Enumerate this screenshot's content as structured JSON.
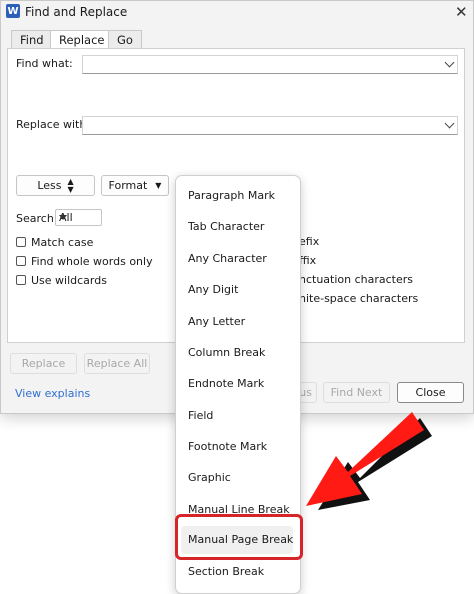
{
  "window": {
    "app_icon": "W",
    "title": "Find and Replace",
    "close_glyph": "✕"
  },
  "tabs": [
    {
      "label": "Find"
    },
    {
      "label": "Replace"
    },
    {
      "label": "Go To"
    }
  ],
  "find": {
    "label": "Find what:",
    "value": ""
  },
  "replace": {
    "label": "Replace with:",
    "value": ""
  },
  "buttons": {
    "less": "Less",
    "format": "Format",
    "replace": "Replace",
    "replace_all": "Replace All",
    "previous_partial": "ous",
    "find_next": "Find Next",
    "close": "Close"
  },
  "search": {
    "label": "Search:",
    "selected": "All"
  },
  "options": [
    {
      "label": "Match case"
    },
    {
      "label": "Find whole words only"
    },
    {
      "label": "Use wildcards"
    }
  ],
  "right_options_partial": [
    "efix",
    "ffix",
    "nctuation characters",
    "hite-space characters"
  ],
  "link": {
    "label": "View explains"
  },
  "special_menu": [
    "Paragraph Mark",
    "Tab Character",
    "Any Character",
    "Any Digit",
    "Any Letter",
    "Column Break",
    "Endnote Mark",
    "Field",
    "Footnote Mark",
    "Graphic",
    "Manual Line Break",
    "Manual Page Break",
    "Section Break"
  ],
  "colors": {
    "accent_link": "#2f6fcf",
    "highlight": "#d6242b",
    "arrow_red": "#ff1a14"
  }
}
